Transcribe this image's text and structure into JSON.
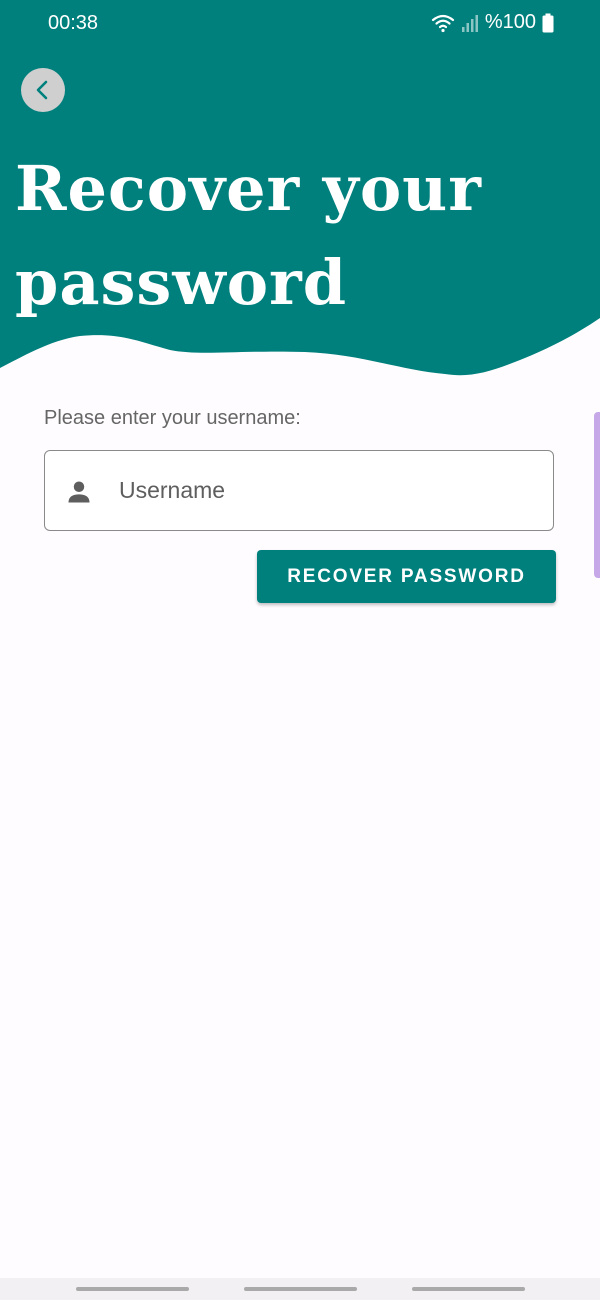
{
  "colors": {
    "primary": "#00807d",
    "background": "#fefcfe",
    "on_primary": "#ffffff"
  },
  "status_bar": {
    "time": "00:38",
    "battery": "%100",
    "icons": [
      "wifi-icon",
      "signal-icon",
      "battery-icon"
    ]
  },
  "header": {
    "back_icon": "chevron-left-icon",
    "title": "Recover your password"
  },
  "form": {
    "prompt": "Please enter your username:",
    "username_icon": "person-icon",
    "username_placeholder": "Username",
    "username_value": "",
    "submit_label": "RECOVER PASSWORD"
  }
}
